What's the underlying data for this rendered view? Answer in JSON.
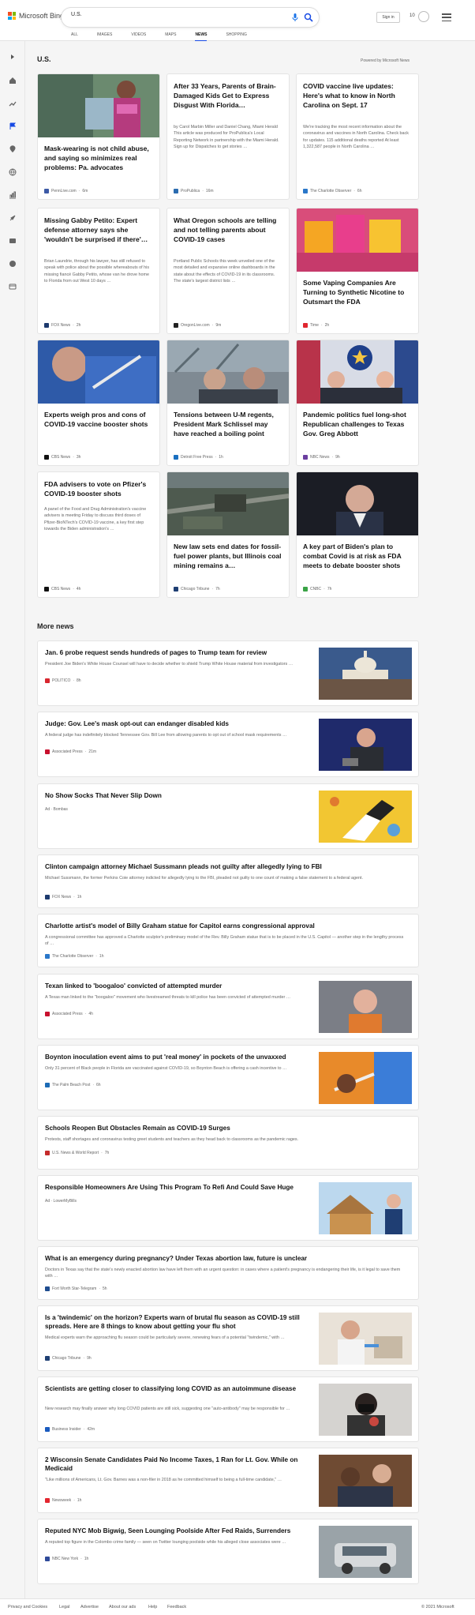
{
  "header": {
    "logo_text": "Microsoft Bing",
    "search_value": "U.S.",
    "signin_label": "Sign in",
    "rewards_count": "10",
    "tabs": [
      "ALL",
      "IMAGES",
      "VIDEOS",
      "MAPS",
      "NEWS",
      "SHOPPING"
    ],
    "active_tab": "NEWS"
  },
  "section": {
    "title": "U.S.",
    "powered_by": "Powered by Microsoft News"
  },
  "cards": [
    {
      "title": "Mask-wearing is not child abuse, and saying so minimizes real problems: Pa. advocates",
      "snippet": "",
      "source": "PennLive.com",
      "age": "6m",
      "src_color": "#3c5aa6"
    },
    {
      "title": "After 33 Years, Parents of Brain-Damaged Kids Get to Express Disgust With Florida…",
      "snippet": "by Carol Marbin Miller and Daniel Chang, Miami Herald This article was produced for ProPublica's Local Reporting Network in partnership with the Miami Herald. Sign up for Dispatches to get stories …",
      "source": "ProPublica",
      "age": "16m",
      "src_color": "#2b6cb0"
    },
    {
      "title": "COVID vaccine live updates: Here's what to know in North Carolina on Sept. 17",
      "snippet": "We're tracking the most recent information about the coronavirus and vaccines in North Carolina. Check back for updates. 115 additional deaths reported At least 1,322,587 people in North Carolina …",
      "source": "The Charlotte Observer",
      "age": "6h",
      "src_color": "#2a77c9"
    },
    {
      "title": "Missing Gabby Petito: Expert defense attorney says she 'wouldn't be surprised if there'…",
      "snippet": "Brian Laundrie, through his lawyer, has still refused to speak with police about the possible whereabouts of his missing fiancé Gabby Petito, whose van he drove home to Florida from out West 10 days …",
      "source": "FOX News",
      "age": "2h",
      "src_color": "#1d3a6e"
    },
    {
      "title": "What Oregon schools are telling and not telling parents about COVID-19 cases",
      "snippet": "Portland Public Schools this week unveiled one of the most detailed and expansive online dashboards in the state about the effects of COVID-19 in its classrooms. The state's largest district lists …",
      "source": "OregonLive.com",
      "age": "9m",
      "src_color": "#222222"
    },
    {
      "title": "Some Vaping Companies Are Turning to Synthetic Nicotine to Outsmart the FDA",
      "snippet": "",
      "source": "Time",
      "age": "2h",
      "src_color": "#e0262f"
    },
    {
      "title": "Experts weigh pros and cons of COVID-19 vaccine booster shots",
      "snippet": "",
      "source": "CBS News",
      "age": "3h",
      "src_color": "#111111"
    },
    {
      "title": "Tensions between U-M regents, President Mark Schlissel may have reached a boiling point",
      "snippet": "",
      "source": "Detroit Free Press",
      "age": "1h",
      "src_color": "#1a6fc0"
    },
    {
      "title": "Pandemic politics fuel long-shot Republican challenges to Texas Gov. Greg Abbott",
      "snippet": "",
      "source": "NBC News",
      "age": "9h",
      "src_color": "#6b3fa0"
    },
    {
      "title": "FDA advisers to vote on Pfizer's COVID-19 booster shots",
      "snippet": "A panel of the Food and Drug Administration's vaccine advisers is meeting Friday to discuss third doses of Pfizer-BioNTech's COVID-19 vaccine, a key first step towards the Biden administration's …",
      "source": "CBS News",
      "age": "4h",
      "src_color": "#111111"
    },
    {
      "title": "New law sets end dates for fossil-fuel power plants, but Illinois coal mining remains a…",
      "snippet": "",
      "source": "Chicago Tribune",
      "age": "7h",
      "src_color": "#1f3f73"
    },
    {
      "title": "A key part of Biden's plan to combat Covid is at risk as FDA meets to debate booster shots",
      "snippet": "",
      "source": "CNBC",
      "age": "7h",
      "src_color": "#3aa346"
    }
  ],
  "more_news": {
    "title": "More news",
    "items": [
      {
        "title": "Jan. 6 probe request sends hundreds of pages to Trump team for review",
        "snippet": "President Joe Biden's White House Counsel will have to decide whether to shield Trump White House material from investigators …",
        "source": "POLITICO",
        "age": "8h",
        "src_color": "#d8262f"
      },
      {
        "title": "Judge: Gov. Lee's mask opt-out can endanger disabled kids",
        "snippet": "A federal judge has indefinitely blocked Tennessee Gov. Bill Lee from allowing parents to opt out of school mask requirements …",
        "source": "Associated Press",
        "age": "21m",
        "src_color": "#c8102e"
      },
      {
        "title": "No Show Socks That Never Slip Down",
        "snippet": "",
        "source": "Ad · Bombas",
        "age": "",
        "src_color": ""
      },
      {
        "title": "Clinton campaign attorney Michael Sussmann pleads not guilty after allegedly lying to FBI",
        "snippet": "Michael Sussmann, the former Perkins Coie attorney indicted for allegedly lying to the FBI, pleaded not guilty to one count of making a false statement to a federal agent.",
        "source": "FOX News",
        "age": "1h",
        "src_color": "#1d3a6e"
      },
      {
        "title": "Charlotte artist's model of Billy Graham statue for Capitol earns congressional approval",
        "snippet": "A congressional committee has approved a Charlotte sculptor's preliminary model of the Rev. Billy Graham statue that is to be placed in the U.S. Capitol — another step in the lengthy process of …",
        "source": "The Charlotte Observer",
        "age": "1h",
        "src_color": "#2a77c9"
      },
      {
        "title": "Texan linked to 'boogaloo' convicted of attempted murder",
        "snippet": "A Texas man linked to the \"boogaloo\" movement who livestreamed threats to kill police has been convicted of attempted murder …",
        "source": "Associated Press",
        "age": "4h",
        "src_color": "#c8102e"
      },
      {
        "title": "Boynton inoculation event aims to put 'real money' in pockets of the unvaxxed",
        "snippet": "Only 31 percent of Black people in Florida are vaccinated against COVID-19, so Boynton Beach is offering a cash incentive to …",
        "source": "The Palm Beach Post",
        "age": "6h",
        "src_color": "#1c6bb5"
      },
      {
        "title": "Schools Reopen But Obstacles Remain as COVID-19 Surges",
        "snippet": "Protests, staff shortages and coronavirus testing greet students and teachers as they head back to classrooms as the pandemic rages.",
        "source": "U.S. News & World Report",
        "age": "7h",
        "src_color": "#c52b2b"
      },
      {
        "title": "Responsible Homeowners Are Using This Program To Refi And Could Save Huge",
        "snippet": "",
        "source": "Ad · LowerMyBills",
        "age": "",
        "src_color": ""
      },
      {
        "title": "What is an emergency during pregnancy? Under Texas abortion law, future is unclear",
        "snippet": "Doctors in Texas say that the state's newly enacted abortion law have left them with an urgent question: in cases where a patient's pregnancy is endangering their life, is it legal to save them with …",
        "source": "Fort Worth Star-Telegram",
        "age": "5h",
        "src_color": "#1f4d8f"
      },
      {
        "title": "Is a 'twindemic' on the horizon? Experts warn of brutal flu season as COVID-19 still spreads. Here are 8 things to know about getting your flu shot",
        "snippet": "Medical experts warn the approaching flu season could be particularly severe, renewing fears of a potential \"twindemic,\" with …",
        "source": "Chicago Tribune",
        "age": "9h",
        "src_color": "#1f3f73"
      },
      {
        "title": "Scientists are getting closer to classifying long COVID as an autoimmune disease",
        "snippet": "New research may finally answer why long COVID patients are still sick, suggesting one \"auto-antibody\" may be responsible for …",
        "source": "Business Insider",
        "age": "42m",
        "src_color": "#1a5bbf"
      },
      {
        "title": "2 Wisconsin Senate Candidates Paid No Income Taxes, 1 Ran for Lt. Gov. While on Medicaid",
        "snippet": "\"Like millions of Americans, Lt. Gov. Barnes was a non-filer in 2018 as he committed himself to being a full-time candidate,\" …",
        "source": "Newsweek",
        "age": "1h",
        "src_color": "#e3262f"
      },
      {
        "title": "Reputed NYC Mob Bigwig, Seen Lounging Poolside After Fed Raids, Surrenders",
        "snippet": "A reputed top figure in the Colombo crime family — seen on Twitter lounging poolside while his alleged close associates were …",
        "source": "NBC New York",
        "age": "1h",
        "src_color": "#2f4a9a"
      }
    ]
  },
  "footer": {
    "links": [
      "Privacy and Cookies",
      "Legal",
      "Advertise",
      "About our ads",
      "Help",
      "Feedback"
    ],
    "copyright": "© 2021 Microsoft"
  }
}
